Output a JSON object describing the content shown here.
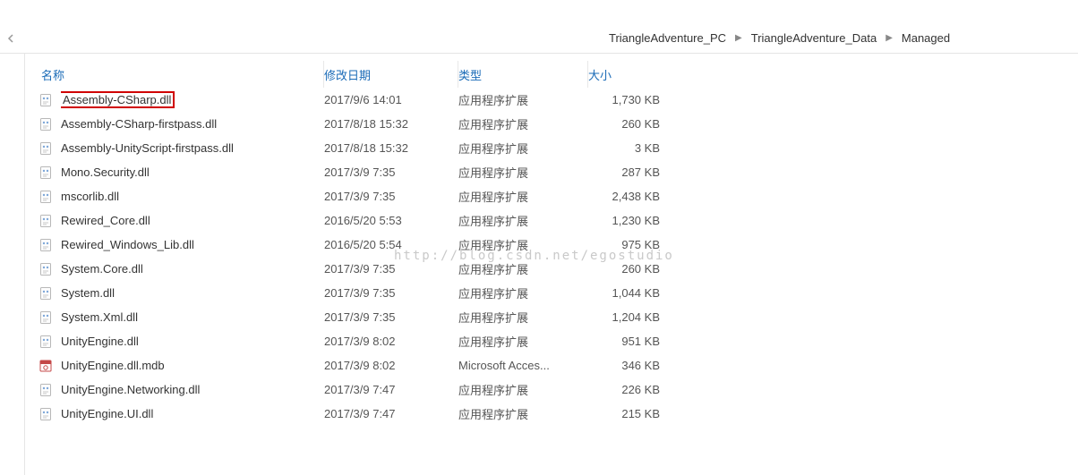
{
  "breadcrumb": {
    "parts": [
      "TriangleAdventure_PC",
      "TriangleAdventure_Data",
      "Managed"
    ]
  },
  "columns": {
    "name": "名称",
    "date": "修改日期",
    "type": "类型",
    "size": "大小"
  },
  "watermark": "http://blog.csdn.net/egostudio",
  "files": [
    {
      "name": "Assembly-CSharp.dll",
      "date": "2017/9/6 14:01",
      "type": "应用程序扩展",
      "size": "1,730 KB",
      "icon": "dll",
      "highlight": true
    },
    {
      "name": "Assembly-CSharp-firstpass.dll",
      "date": "2017/8/18 15:32",
      "type": "应用程序扩展",
      "size": "260 KB",
      "icon": "dll"
    },
    {
      "name": "Assembly-UnityScript-firstpass.dll",
      "date": "2017/8/18 15:32",
      "type": "应用程序扩展",
      "size": "3 KB",
      "icon": "dll"
    },
    {
      "name": "Mono.Security.dll",
      "date": "2017/3/9 7:35",
      "type": "应用程序扩展",
      "size": "287 KB",
      "icon": "dll"
    },
    {
      "name": "mscorlib.dll",
      "date": "2017/3/9 7:35",
      "type": "应用程序扩展",
      "size": "2,438 KB",
      "icon": "dll"
    },
    {
      "name": "Rewired_Core.dll",
      "date": "2016/5/20 5:53",
      "type": "应用程序扩展",
      "size": "1,230 KB",
      "icon": "dll"
    },
    {
      "name": "Rewired_Windows_Lib.dll",
      "date": "2016/5/20 5:54",
      "type": "应用程序扩展",
      "size": "975 KB",
      "icon": "dll"
    },
    {
      "name": "System.Core.dll",
      "date": "2017/3/9 7:35",
      "type": "应用程序扩展",
      "size": "260 KB",
      "icon": "dll"
    },
    {
      "name": "System.dll",
      "date": "2017/3/9 7:35",
      "type": "应用程序扩展",
      "size": "1,044 KB",
      "icon": "dll"
    },
    {
      "name": "System.Xml.dll",
      "date": "2017/3/9 7:35",
      "type": "应用程序扩展",
      "size": "1,204 KB",
      "icon": "dll"
    },
    {
      "name": "UnityEngine.dll",
      "date": "2017/3/9 8:02",
      "type": "应用程序扩展",
      "size": "951 KB",
      "icon": "dll"
    },
    {
      "name": "UnityEngine.dll.mdb",
      "date": "2017/3/9 8:02",
      "type": "Microsoft Acces...",
      "size": "346 KB",
      "icon": "mdb"
    },
    {
      "name": "UnityEngine.Networking.dll",
      "date": "2017/3/9 7:47",
      "type": "应用程序扩展",
      "size": "226 KB",
      "icon": "dll"
    },
    {
      "name": "UnityEngine.UI.dll",
      "date": "2017/3/9 7:47",
      "type": "应用程序扩展",
      "size": "215 KB",
      "icon": "dll"
    }
  ]
}
